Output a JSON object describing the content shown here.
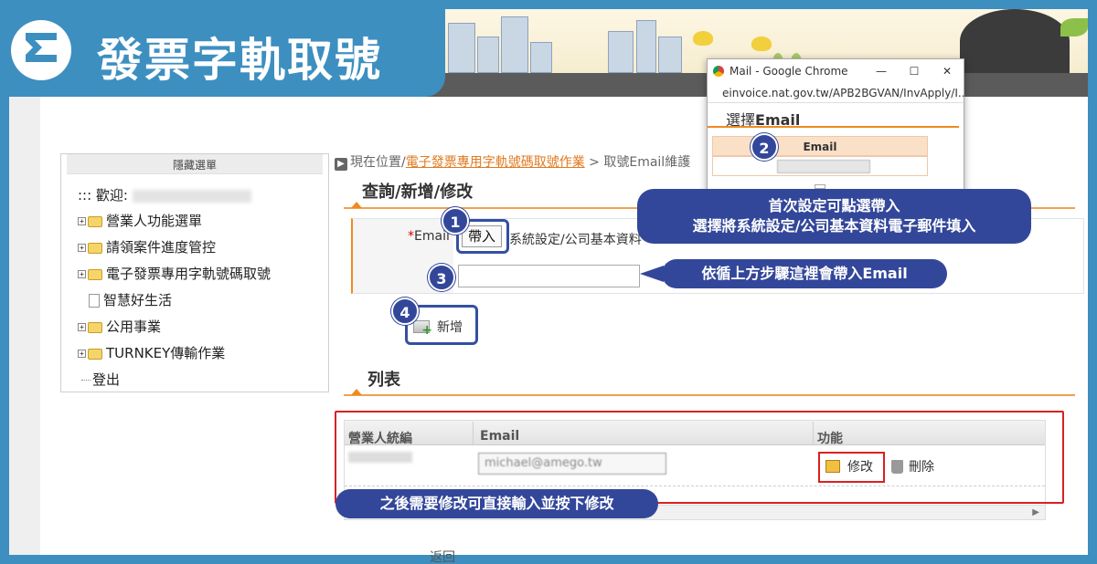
{
  "title_badge": {
    "logo_letter": "E",
    "title": "發票字軌取號",
    "background": "#3d8fc0"
  },
  "sidebar": {
    "header": "隱藏選單",
    "welcome_prefix": "::: 歡迎:",
    "items": [
      {
        "label": "營業人功能選單",
        "icon": "folder-icon",
        "expandable": true
      },
      {
        "label": "請領案件進度管控",
        "icon": "folder-icon",
        "expandable": true
      },
      {
        "label": "電子發票專用字軌號碼取號",
        "icon": "folder-icon",
        "expandable": true
      },
      {
        "label": "智慧好生活",
        "icon": "document-icon",
        "expandable": false
      },
      {
        "label": "公用事業",
        "icon": "folder-icon",
        "expandable": true
      },
      {
        "label": "TURNKEY傳輸作業",
        "icon": "folder-icon",
        "expandable": true
      },
      {
        "label": "登出",
        "icon": "",
        "expandable": false
      }
    ]
  },
  "breadcrumb": {
    "prefix": "現在位置/",
    "link": "電子發票專用字軌號碼取號作業",
    "current": " > 取號Email維護"
  },
  "query_section": {
    "title": "查詢/新增/修改",
    "email_label": "Email",
    "required_mark": "*",
    "import_button": "帶入",
    "import_hint": "系統設定/公司基本資料",
    "email_value": "",
    "add_button": "新增"
  },
  "list_section": {
    "title": "列表",
    "columns": [
      "營業人統編",
      "Email",
      "功能"
    ],
    "rows": [
      {
        "email": "michael@amego.tw",
        "edit": "修改",
        "delete": "刪除"
      }
    ]
  },
  "popup": {
    "window_title": "Mail - Google Chrome",
    "url": "einvoice.nat.gov.tw/APB2BGVAN/InvApply/I...",
    "heading_prefix": "選擇",
    "heading_bold": "Email",
    "column": "Email",
    "row_email": "michael@amego.tw",
    "controls": [
      "—",
      "☐",
      "✕"
    ]
  },
  "callouts": {
    "first": [
      "首次設定可點選帶入",
      "選擇將系統設定/公司基本資料電子郵件填入"
    ],
    "second": "依循上方步驟這裡會帶入Email",
    "third": "之後需要修改可直接輸入並按下修改"
  },
  "step_numbers": [
    "1",
    "2",
    "3",
    "4"
  ],
  "back_link": "返回",
  "colors": {
    "accent_blue": "#33479a",
    "brand_blue": "#3d8fc0",
    "orange": "#f08a20",
    "highlight_red": "#d92020"
  }
}
